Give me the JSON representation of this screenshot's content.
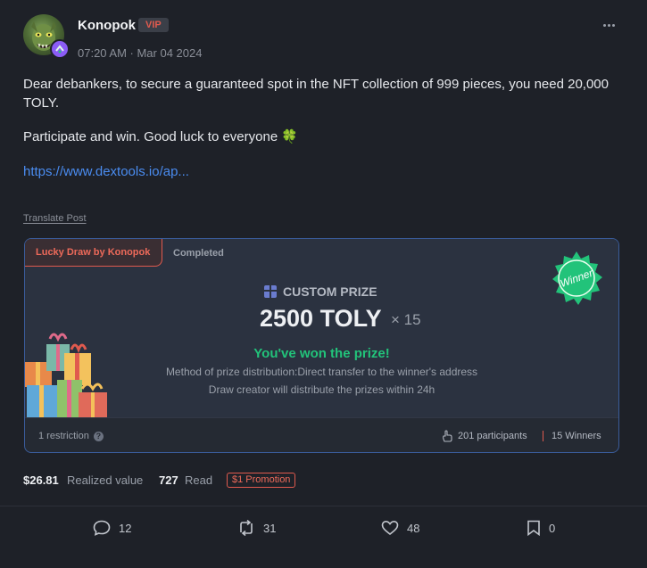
{
  "post": {
    "author": "Konopok",
    "badge": "VIP",
    "timestamp": "07:20 AM · Mar 04 2024",
    "body": "Dear debankers, to secure a guaranteed spot in the NFT collection of 999 pieces, you need 20,000 TOLY.",
    "body2": "Participate and win. Good luck to everyone 🍀",
    "link": "https://www.dextools.io/ap...",
    "translate": "Translate Post"
  },
  "draw": {
    "tab": "Lucky Draw by Konopok",
    "status": "Completed",
    "prize_label": "CUSTOM PRIZE",
    "prize_amount": "2500 TOLY",
    "prize_multiplier": "× 15",
    "won": "You've won the prize!",
    "method": "Method of prize distribution:Direct transfer to the winner's address",
    "distribute": "Draw creator will distribute the prizes within 24h",
    "seal_text": "Winner",
    "restriction": "1 restriction",
    "participants": "201 participants",
    "winners": "15 Winners"
  },
  "stats": {
    "realized_value": "$26.81",
    "realized_label": "Realized value",
    "read_count": "727",
    "read_label": "Read",
    "promotion": "$1 Promotion"
  },
  "actions": {
    "comments": "12",
    "reposts": "31",
    "likes": "48",
    "bookmarks": "0"
  },
  "colors": {
    "background": "#1e2128",
    "accent": "#e05a4e",
    "link": "#4a8cf0",
    "success": "#22c37a",
    "card_border": "#3a5c9a"
  },
  "icons": [
    "more-icon",
    "gift-icon",
    "help-icon",
    "hand-icon",
    "comment-icon",
    "repost-icon",
    "heart-icon",
    "bookmark-icon"
  ]
}
